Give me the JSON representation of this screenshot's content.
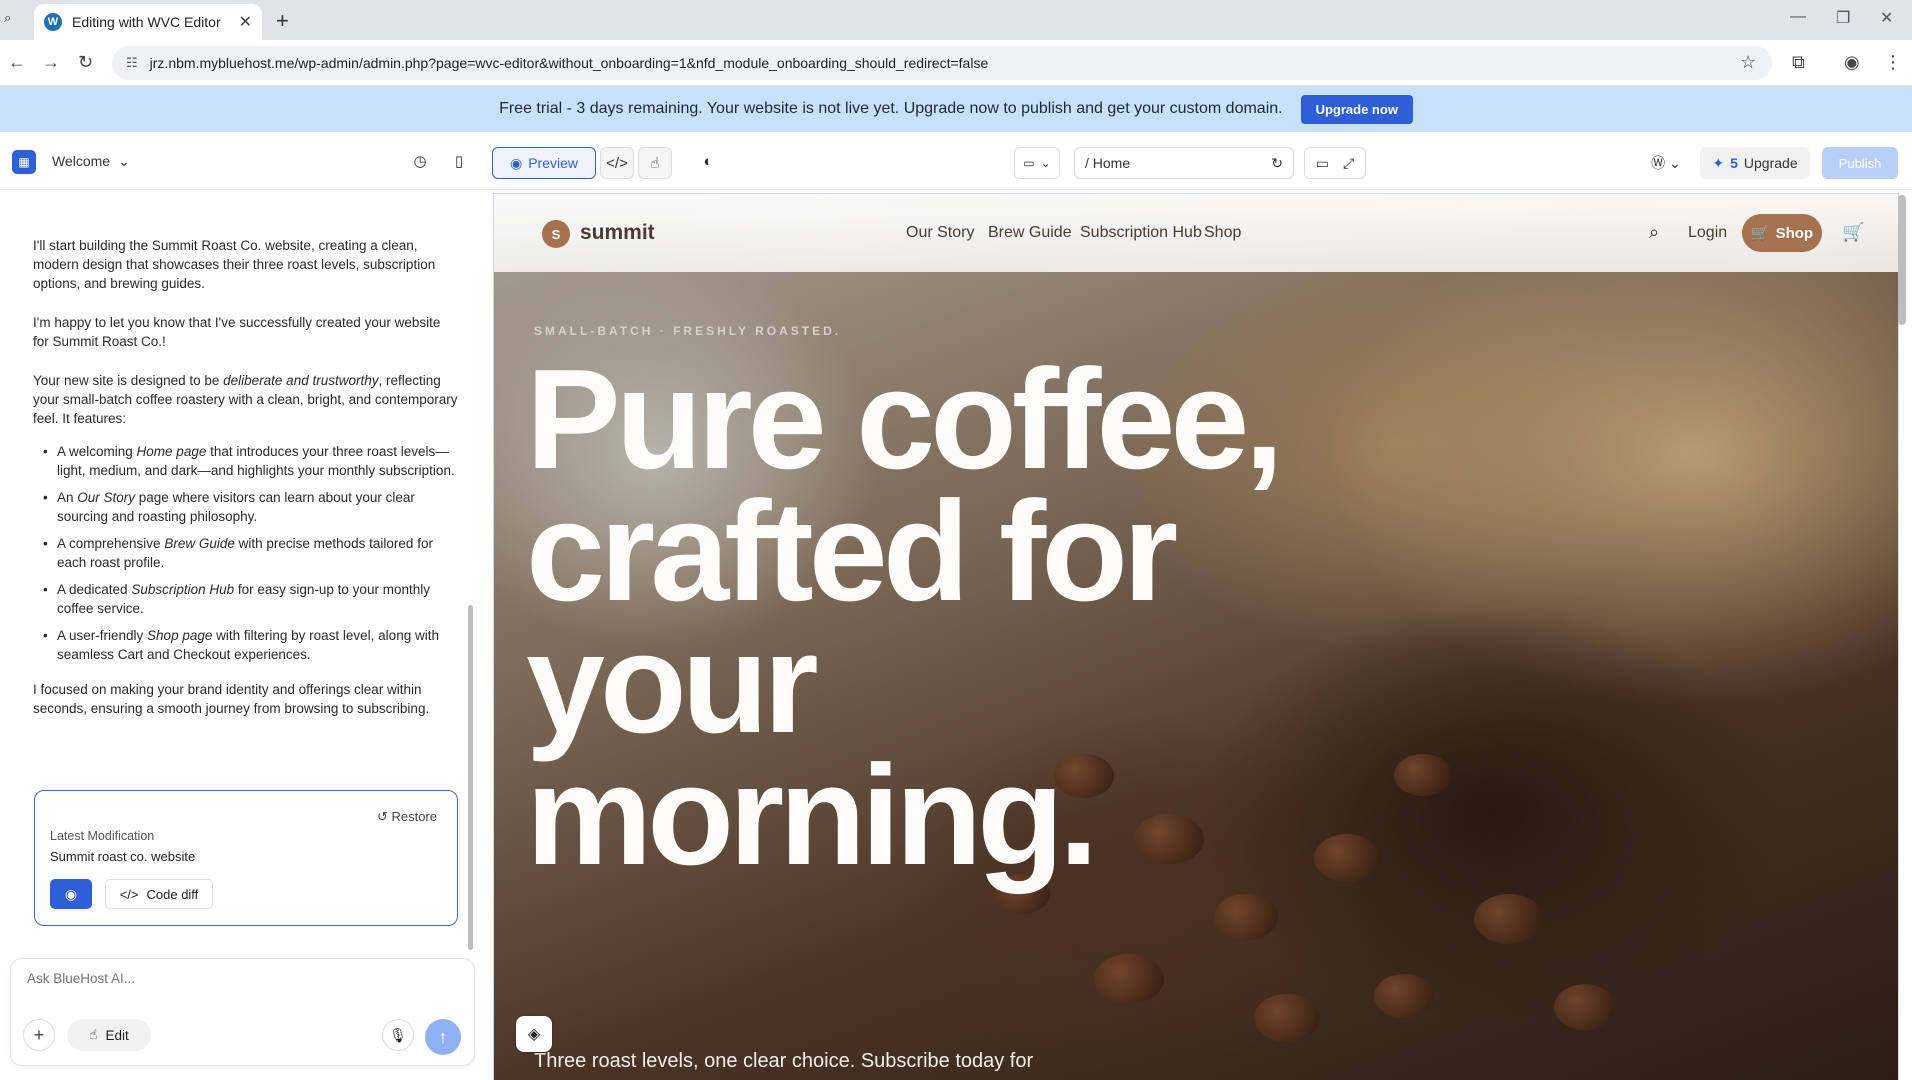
{
  "browser": {
    "tab_title": "Editing with WVC Editor",
    "url": "jrz.nbm.mybluehost.me/wp-admin/admin.php?page=wvc-editor&without_onboarding=1&nfd_module_onboarding_should_redirect=false"
  },
  "banner": {
    "text": "Free trial - 3 days remaining. Your website is not live yet. Upgrade now to publish and get your custom domain.",
    "button": "Upgrade now"
  },
  "toolbar": {
    "welcome": "Welcome",
    "preview": "Preview",
    "page_path": "/ Home",
    "credits": "5",
    "upgrade": "Upgrade",
    "publish": "Publish"
  },
  "chat": {
    "p1": "I'll start building the Summit Roast Co. website, creating a clean, modern design that showcases their three roast levels, subscription options, and brewing guides.",
    "p2": "I'm happy to let you know that I've successfully created your website for Summit Roast Co.!",
    "p3_pre": "Your new site is designed to be ",
    "p3_em": "deliberate and trustworthy",
    "p3_post": ", reflecting your small-batch coffee roastery with a clean, bright, and contemporary feel. It features:",
    "items": [
      {
        "pre": "A welcoming ",
        "em": "Home page",
        "post": " that introduces your three roast levels—light, medium, and dark—and highlights your monthly subscription."
      },
      {
        "pre": "An ",
        "em": "Our Story",
        "post": " page where visitors can learn about your clear sourcing and roasting philosophy."
      },
      {
        "pre": "A comprehensive ",
        "em": "Brew Guide",
        "post": " with precise methods tailored for each roast profile."
      },
      {
        "pre": "A dedicated ",
        "em": "Subscription Hub",
        "post": " for easy sign-up to your monthly coffee service."
      },
      {
        "pre": "A user-friendly ",
        "em": "Shop page",
        "post": " with filtering by roast level, along with seamless Cart and Checkout experiences."
      }
    ],
    "p4": "I focused on making your brand identity and offerings clear within seconds, ensuring a smooth journey from browsing to subscribing."
  },
  "card": {
    "restore": "Restore",
    "label": "Latest Modification",
    "site": "Summit roast co. website",
    "diff": "Code diff"
  },
  "composer": {
    "placeholder": "Ask BlueHost AI...",
    "edit": "Edit"
  },
  "site": {
    "logo_letter": "S",
    "logo": "summit",
    "menu": [
      "Our Story",
      "Brew Guide",
      "Subscription Hub",
      "Shop"
    ],
    "login": "Login",
    "shop_button": "Shop",
    "eyebrow": "SMALL-BATCH · FRESHLY ROASTED.",
    "headline": "Pure coffee, crafted for your morning.",
    "subline": "Three roast levels, one clear choice. Subscribe today for"
  },
  "colors": {
    "accent": "#2f5fd8",
    "banner": "#c7e1fb",
    "brand": "#a5714e"
  }
}
